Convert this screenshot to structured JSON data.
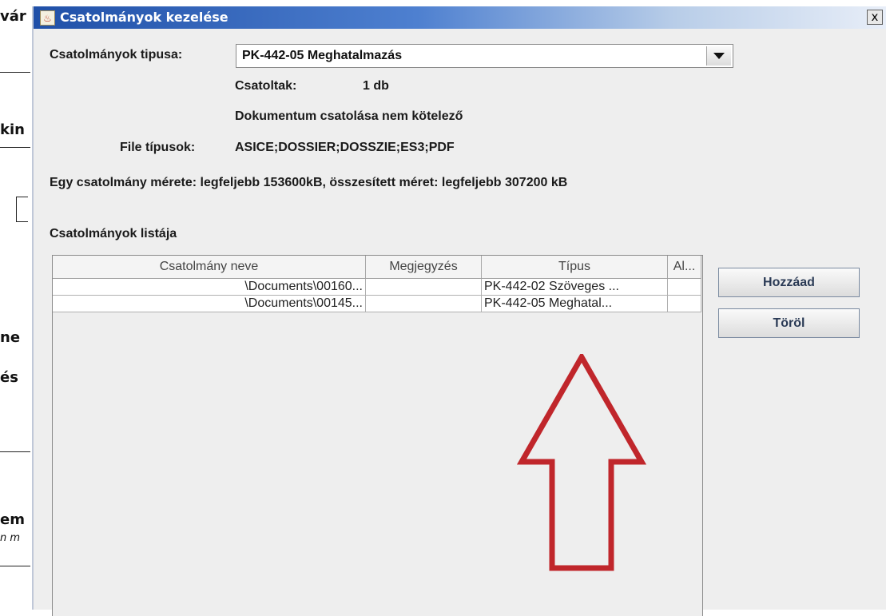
{
  "background": {
    "fragments": [
      "vár",
      "kin",
      "ne",
      "és",
      "em",
      "n m"
    ]
  },
  "dialog": {
    "title": "Csatolmányok kezelése",
    "close_label": "x",
    "type_label": "Csatolmányok tipusa:",
    "type_value": "PK-442-05 Meghatalmazás",
    "attached_label": "Csatoltak:",
    "attached_value": "1 db",
    "optional_note": "Dokumentum csatolása nem kötelező",
    "filetypes_label": "File típusok:",
    "filetypes_value": "ASICE;DOSSIER;DOSSZIE;ES3;PDF",
    "size_info": "Egy csatolmány mérete: legfeljebb 153600kB, összesített méret: legfeljebb 307200 kB",
    "list_title": "Csatolmányok listája",
    "table": {
      "columns": [
        "Csatolmány neve",
        "Megjegyzés",
        "Típus",
        "Al..."
      ],
      "rows": [
        {
          "name": "\\Documents\\00160...",
          "note": "",
          "type": "PK-442-02 Szöveges ...",
          "al": ""
        },
        {
          "name": "\\Documents\\00145...",
          "note": "",
          "type": "PK-442-05 Meghatal...",
          "al": ""
        }
      ]
    },
    "add_button": "Hozzáad",
    "delete_button": "Töröl"
  },
  "colors": {
    "titlebar_start": "#2050a8",
    "annotation_arrow": "#c0262b"
  }
}
